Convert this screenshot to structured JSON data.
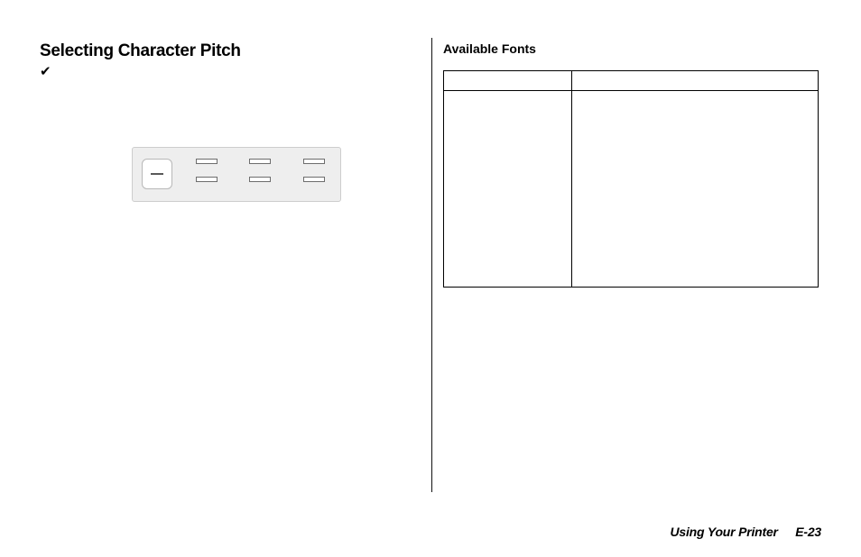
{
  "left": {
    "heading": "Selecting Character Pitch",
    "check_glyph": "✔"
  },
  "right": {
    "subheading": "Available Fonts",
    "table": {
      "headers": [
        "",
        ""
      ],
      "body_cells": [
        "",
        ""
      ]
    }
  },
  "footer": {
    "title": "Using Your Printer",
    "page_label": "E-23"
  }
}
